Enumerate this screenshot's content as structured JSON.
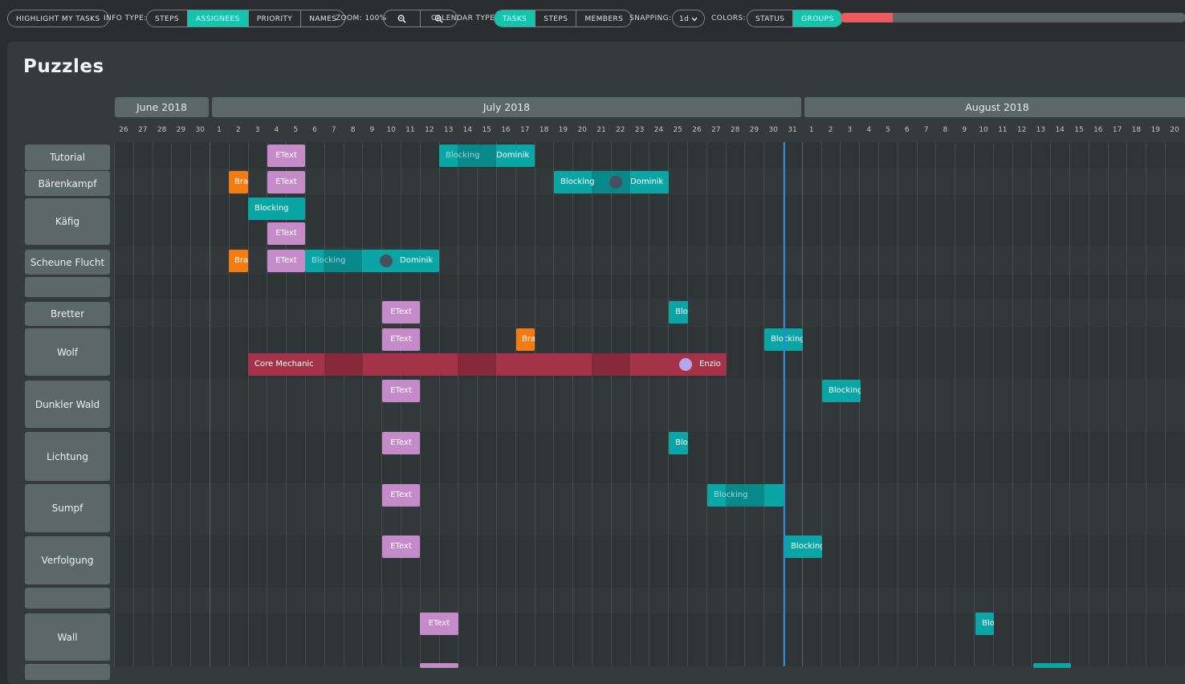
{
  "toolbar": {
    "highlight_label": "HIGHLIGHT MY TASKS",
    "info_type_label": "INFO TYPE:",
    "info_type_options": [
      "STEPS",
      "ASSIGNEES",
      "PRIORITY",
      "NAMES"
    ],
    "info_type_active": "ASSIGNEES",
    "zoom_label": "ZOOM: 100%",
    "calendar_type_label": "CALENDAR TYPE:",
    "calendar_type_options": [
      "TASKS",
      "STEPS",
      "MEMBERS"
    ],
    "calendar_type_active": "TASKS",
    "snapping_label": "SNAPPING:",
    "snapping_value": "1d",
    "colors_label": "COLORS:",
    "colors_options": [
      "STATUS",
      "GROUPS"
    ],
    "colors_active": "GROUPS",
    "progress_fraction": 0.15
  },
  "title": "Puzzles",
  "months": [
    "June 2018",
    "July 2018",
    "August 2018"
  ],
  "days": [
    "26",
    "27",
    "28",
    "29",
    "30",
    "1",
    "2",
    "3",
    "4",
    "5",
    "6",
    "7",
    "8",
    "9",
    "10",
    "11",
    "12",
    "13",
    "14",
    "15",
    "16",
    "17",
    "18",
    "19",
    "20",
    "21",
    "22",
    "23",
    "24",
    "25",
    "26",
    "27",
    "28",
    "29",
    "30",
    "31",
    "1",
    "2",
    "3",
    "4",
    "5",
    "6",
    "7",
    "8",
    "9",
    "10",
    "11",
    "12",
    "13",
    "14",
    "15",
    "16",
    "17",
    "18",
    "19",
    "20"
  ],
  "rows": [
    "Tutorial",
    "Bärenkampf",
    "Käfig",
    "Scheune Flucht",
    "",
    "Bretter",
    "Wolf",
    "Dunkler Wald",
    "Lichtung",
    "Sumpf",
    "Verfolgung",
    "",
    "Wall"
  ],
  "bars": [
    {
      "text": "EText"
    },
    {
      "text": "Blocking"
    },
    {
      "text": "Dominik"
    },
    {
      "text": "Bra"
    },
    {
      "text": "EText"
    },
    {
      "text": "Blocking"
    },
    {
      "text": "Dominik"
    },
    {
      "text": "Blocking"
    },
    {
      "text": "EText"
    },
    {
      "text": "Bra"
    },
    {
      "text": "EText"
    },
    {
      "text": "Blocking"
    },
    {
      "text": "Dominik"
    },
    {
      "text": "EText"
    },
    {
      "text": "Blo"
    },
    {
      "text": "EText"
    },
    {
      "text": "Bra"
    },
    {
      "text": "Blocking"
    },
    {
      "text": "Core Mechanic"
    },
    {
      "text": "Enzio"
    },
    {
      "text": "EText"
    },
    {
      "text": "Blocking"
    },
    {
      "text": "EText"
    },
    {
      "text": "Blo"
    },
    {
      "text": "EText"
    },
    {
      "text": "Blocking"
    },
    {
      "text": "EText"
    },
    {
      "text": "Blocking"
    },
    {
      "text": "EText"
    },
    {
      "text": "Blo"
    }
  ],
  "colors": {
    "accent": "#11c6ad",
    "task_teal": "#0aa6a6",
    "task_pink": "#c58bc9",
    "task_orange": "#f47a12",
    "task_red": "#a33349",
    "today_line": "#2d8ad6",
    "progress_fill": "#ea5a5e"
  }
}
